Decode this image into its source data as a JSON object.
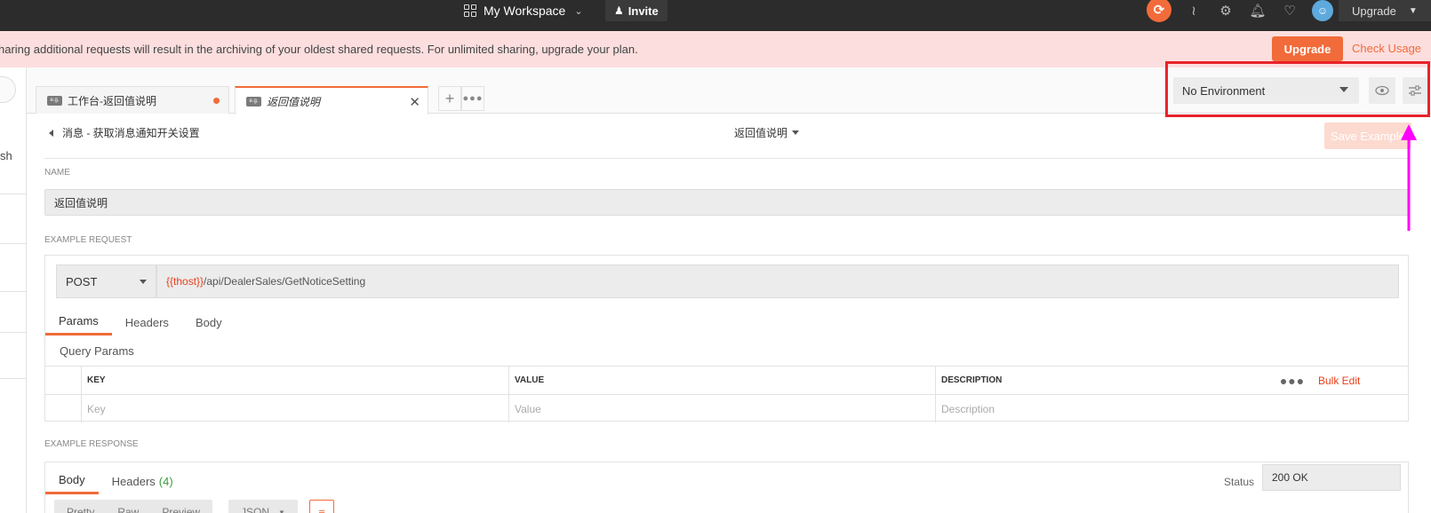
{
  "topbar": {
    "workspace_label": "My Workspace",
    "invite_label": "Invite",
    "upgrade_label": "Upgrade"
  },
  "banner": {
    "text": "haring additional requests will result in the archiving of your oldest shared requests. For unlimited sharing, upgrade your plan.",
    "upgrade_label": "Upgrade",
    "check_usage_label": "Check Usage"
  },
  "sidebar": {
    "partial_text": "sh"
  },
  "tabs": [
    {
      "label": "工作台-返回值说明",
      "badge": "e.g.",
      "unsaved": true
    },
    {
      "label": "返回值说明",
      "badge": "e.g.",
      "active": true
    }
  ],
  "environment": {
    "selected": "No Environment"
  },
  "example": {
    "breadcrumb": "消息 - 获取消息通知开关设置",
    "title": "返回值说明",
    "save_label": "Save Example",
    "name_label": "NAME",
    "name_value": "返回值说明",
    "request_label": "EXAMPLE REQUEST",
    "method": "POST",
    "url_var": "{{thost}}",
    "url_path": "/api/DealerSales/GetNoticeSetting",
    "request_tabs": [
      "Params",
      "Headers",
      "Body"
    ],
    "query_params_title": "Query Params",
    "params_table": {
      "headers": [
        "KEY",
        "VALUE",
        "DESCRIPTION"
      ],
      "placeholders": [
        "Key",
        "Value",
        "Description"
      ],
      "bulk_edit_label": "Bulk Edit"
    },
    "response_label": "EXAMPLE RESPONSE",
    "response_tabs": {
      "body": "Body",
      "headers": "Headers",
      "headers_count": "(4)"
    },
    "status_label": "Status",
    "status_value": "200 OK",
    "format_tabs": [
      "Pretty",
      "Raw",
      "Preview"
    ],
    "format_type": "JSON"
  },
  "colors": {
    "accent": "#f26b3a",
    "banner_bg": "#fcdede",
    "topbar_bg": "#2c2c2c",
    "highlight_box": "#e8232a",
    "annotation_arrow": "#ff00ff"
  }
}
